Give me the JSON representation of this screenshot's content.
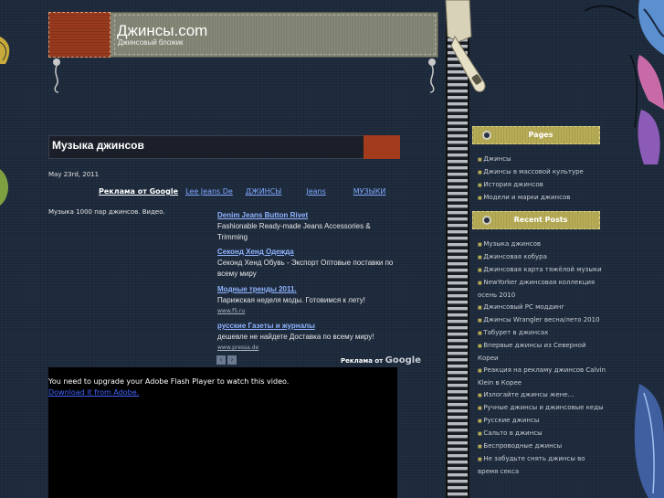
{
  "site": {
    "title": "Джинсы.com",
    "subtitle": "Джинсовый бложик"
  },
  "post": {
    "title": "Музыка джинсов",
    "date": "May 23rd, 2011",
    "text": "Музыка 1000 пар джинсов. Видео."
  },
  "ads_links": {
    "label": "Реклама от Google",
    "links": [
      "Lee Jeans De",
      "ДЖИНСЫ",
      "Jeans",
      "МУЗЫКИ"
    ]
  },
  "ads": [
    {
      "title": "Denim Jeans Button Rivet",
      "desc": "Fashionable Ready-made Jeans Accessories & Trimming",
      "url": ""
    },
    {
      "title": "Секонд Хенд Одежда",
      "desc": "Секонд Хенд Обувь - Экспорт Оптовые поставки по всему миру",
      "url": ""
    },
    {
      "title": "Модные тренды 2011.",
      "desc": "Парижская неделя моды. Готовимся к лету!",
      "url": "www.f5.ru"
    },
    {
      "title": "русские Газеты и журналы",
      "desc": "дешевле не найдете Доставка по всему миру!",
      "url": "www.pressa.de"
    }
  ],
  "ads_nav": {
    "prev": "‹",
    "next": "›"
  },
  "ads_by": {
    "label": "Реклама от",
    "brand": "Google"
  },
  "video": {
    "message": "You need to upgrade your Adobe Flash Player to watch this video.",
    "link": "Download it from Adobe."
  },
  "sidebar": {
    "pages": {
      "title": "Pages",
      "items": [
        "Джинсы",
        "Джинсы в массовой культуре",
        "История джинсов",
        "Модели и марки джинсов"
      ]
    },
    "recent": {
      "title": "Recent Posts",
      "items": [
        "Музыка джинсов",
        "Джинсовая кобура",
        "Джинсовая карта тяжёлой музыки",
        "NewYorker джинсовая коллекция осень 2010",
        "Джинсовый PC моддинг",
        "Джинсы Wrangler весна/лето 2010",
        "Табурет в джинсах",
        "Впервые джинсы из Северной Кореи",
        "Реакция на рекламу джинсов Calvin Klein в Корее",
        "Излогайте джинсы жене…",
        "Ручные джинсы и джинсовые кеды",
        "Русские джинсы",
        "Сальто в джинсы",
        "Беспроводные джинсы",
        "Не забудьте снять джинсы во время секса"
      ]
    }
  },
  "colors": {
    "background": "#1d2a3c",
    "link": "#7fa8ff",
    "accent_orange": "#a23c1d",
    "sidebar_head": "#b7ac56"
  }
}
